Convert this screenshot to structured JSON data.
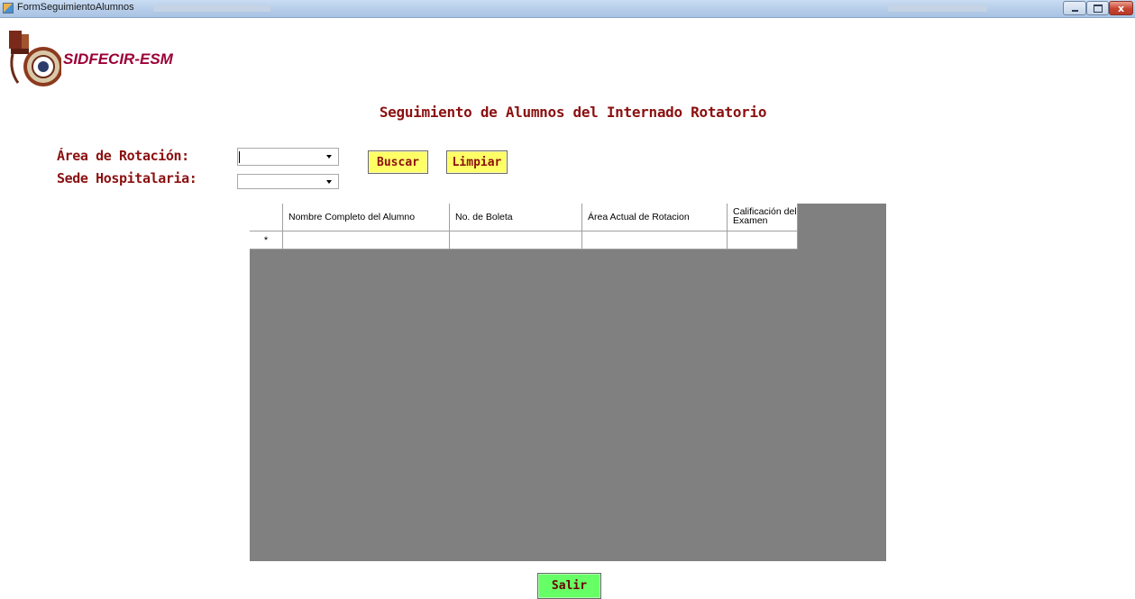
{
  "window": {
    "title": "FormSeguimientoAlumnos",
    "close_label": "x"
  },
  "brand": {
    "name": "SIDFECIR-ESM"
  },
  "page": {
    "title": "Seguimiento de Alumnos del Internado Rotatorio"
  },
  "filters": {
    "area_label": "Área de Rotación:",
    "area_value": "",
    "sede_label": "Sede Hospitalaria:",
    "sede_value": ""
  },
  "buttons": {
    "buscar": "Buscar",
    "limpiar": "Limpiar",
    "salir": "Salir"
  },
  "grid": {
    "columns": [
      "Nombre Completo del Alumno",
      "No. de Boleta",
      "Área Actual de Rotacion",
      "Calificación del Examen"
    ],
    "new_row_marker": "*"
  },
  "colors": {
    "label_text": "#8b1010",
    "brand_text": "#9b0036",
    "button_yellow": "#ffff66",
    "button_green": "#66ff66",
    "grid_background": "#808080"
  }
}
